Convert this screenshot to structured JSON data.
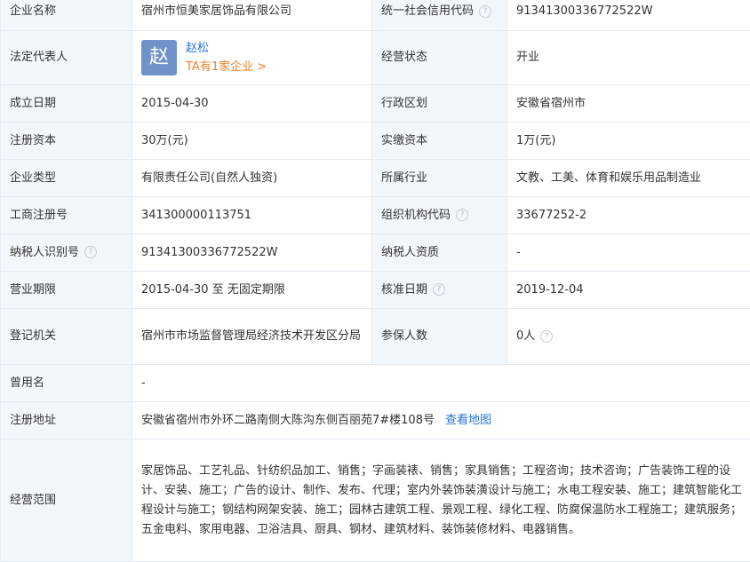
{
  "rows": [
    {
      "k1": "企业名称",
      "v1": "宿州市恒美家居饰品有限公司",
      "k2": "统一社会信用代码",
      "v2": "91341300336772522W"
    },
    {
      "k1": "法定代表人",
      "avatar": "赵",
      "person": "赵松",
      "more": "TA有1家企业 >",
      "k2": "经营状态",
      "v2": "开业"
    },
    {
      "k1": "成立日期",
      "v1": "2015-04-30",
      "k2": "行政区划",
      "v2": "安徽省宿州市"
    },
    {
      "k1": "注册资本",
      "v1": "30万(元)",
      "k2": "实缴资本",
      "v2": "1万(元)"
    },
    {
      "k1": "企业类型",
      "v1": "有限责任公司(自然人独资)",
      "k2": "所属行业",
      "v2": "文教、工美、体育和娱乐用品制造业"
    },
    {
      "k1": "工商注册号",
      "v1": "341300000113751",
      "k2": "组织机构代码",
      "v2": "33677252-2"
    },
    {
      "k1": "纳税人识别号",
      "v1": "91341300336772522W",
      "k2": "纳税人资质",
      "v2": "-"
    },
    {
      "k1": "营业期限",
      "v1": "2015-04-30 至 无固定期限",
      "k2": "核准日期",
      "v2": "2019-12-04"
    },
    {
      "k1": "登记机关",
      "v1": "宿州市市场监督管理局经济技术开发区分局",
      "k2": "参保人数",
      "v2": "0人"
    },
    {
      "k1": "曾用名",
      "v1": "-"
    },
    {
      "k1": "注册地址",
      "v1": "安徽省宿州市外环二路南侧大陈沟东侧百丽苑7#楼108号",
      "link": "查看地图"
    },
    {
      "k1": "经营范围",
      "v1": "家居饰品、工艺礼品、针纺织品加工、销售；字画装裱、销售；家具销售；工程咨询；技术咨询；广告装饰工程的设计、安装、施工；广告的设计、制作、发布、代理；室内外装饰装潢设计与施工；水电工程安装、施工；建筑智能化工程设计与施工；钢结构网架安装、施工；园林古建筑工程、景观工程、绿化工程、防腐保温防水工程施工；建筑服务；五金电料、家用电器、卫浴洁具、厨具、钢材、建筑材料、装饰装修材料、电器销售。"
    }
  ],
  "help_icon": "question-icon",
  "help_glyph": "?",
  "colors": {
    "label_bg": "#f2f7fc",
    "border": "#e4eaf2",
    "link": "#2a75d9",
    "more": "#f37e29",
    "avatar": "#6f93c8"
  }
}
